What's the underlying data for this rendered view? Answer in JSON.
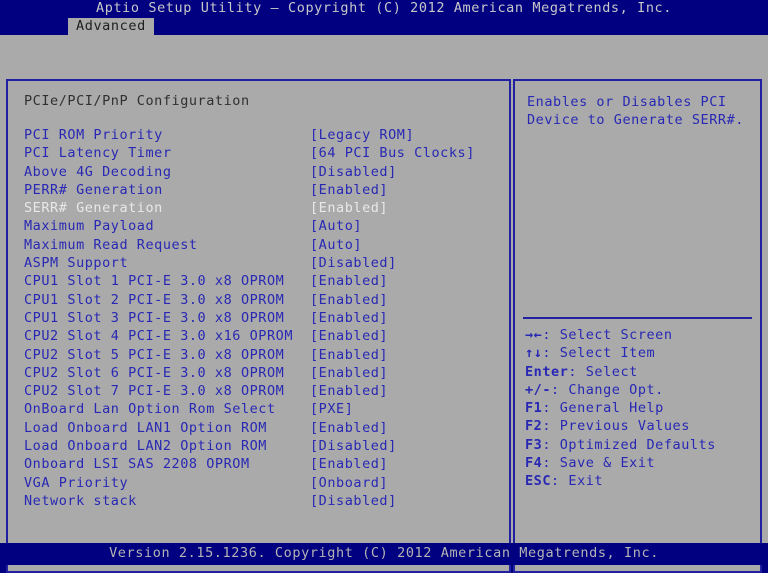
{
  "header": {
    "title": "Aptio Setup Utility – Copyright (C) 2012 American Megatrends, Inc.",
    "tabs": [
      {
        "label": "Advanced",
        "active": true
      }
    ]
  },
  "main": {
    "section_title": "PCIe/PCI/PnP Configuration",
    "options": [
      {
        "label": "PCI ROM Priority",
        "value": "[Legacy ROM]",
        "selected": false
      },
      {
        "label": "PCI Latency Timer",
        "value": "[64 PCI Bus Clocks]",
        "selected": false
      },
      {
        "label": "Above 4G Decoding",
        "value": "[Disabled]",
        "selected": false
      },
      {
        "label": "PERR# Generation",
        "value": "[Enabled]",
        "selected": false
      },
      {
        "label": "SERR# Generation",
        "value": "[Enabled]",
        "selected": true
      },
      {
        "label": "Maximum Payload",
        "value": "[Auto]",
        "selected": false
      },
      {
        "label": "Maximum Read Request",
        "value": "[Auto]",
        "selected": false
      },
      {
        "label": "ASPM Support",
        "value": "[Disabled]",
        "selected": false
      },
      {
        "label": "CPU1 Slot 1 PCI-E 3.0 x8 OPROM",
        "value": "[Enabled]",
        "selected": false
      },
      {
        "label": "CPU1 Slot 2 PCI-E 3.0 x8 OPROM",
        "value": "[Enabled]",
        "selected": false
      },
      {
        "label": "CPU1 Slot 3 PCI-E 3.0 x8 OPROM",
        "value": "[Enabled]",
        "selected": false
      },
      {
        "label": "CPU2 Slot 4 PCI-E 3.0 x16 OPROM",
        "value": "[Enabled]",
        "selected": false
      },
      {
        "label": "CPU2 Slot 5 PCI-E 3.0 x8 OPROM",
        "value": "[Enabled]",
        "selected": false
      },
      {
        "label": "CPU2 Slot 6 PCI-E 3.0 x8 OPROM",
        "value": "[Enabled]",
        "selected": false
      },
      {
        "label": "CPU2 Slot 7 PCI-E 3.0 x8 OPROM",
        "value": "[Enabled]",
        "selected": false
      },
      {
        "label": "OnBoard Lan Option Rom Select",
        "value": "[PXE]",
        "selected": false
      },
      {
        "label": "Load Onboard LAN1 Option ROM",
        "value": "[Enabled]",
        "selected": false
      },
      {
        "label": "Load Onboard LAN2 Option ROM",
        "value": "[Disabled]",
        "selected": false
      },
      {
        "label": "Onboard LSI SAS 2208 OPROM",
        "value": "[Enabled]",
        "selected": false
      },
      {
        "label": "VGA Priority",
        "value": "[Onboard]",
        "selected": false
      },
      {
        "label": "Network stack",
        "value": "[Disabled]",
        "selected": false
      }
    ]
  },
  "help": {
    "text": "Enables or Disables PCI Device to Generate SERR#."
  },
  "keys": [
    {
      "glyph": "→←",
      "label": ": Select Screen"
    },
    {
      "glyph": "↑↓",
      "label": ": Select Item"
    },
    {
      "glyph": "Enter",
      "label": ": Select"
    },
    {
      "glyph": "+/-",
      "label": ": Change Opt."
    },
    {
      "glyph": "F1",
      "label": ": General Help"
    },
    {
      "glyph": "F2",
      "label": ": Previous Values"
    },
    {
      "glyph": "F3",
      "label": ": Optimized Defaults"
    },
    {
      "glyph": "F4",
      "label": ": Save & Exit"
    },
    {
      "glyph": "ESC",
      "label": ": Exit"
    }
  ],
  "footer": {
    "text": "Version 2.15.1236. Copyright (C) 2012 American Megatrends, Inc."
  },
  "colors": {
    "background_blue": "#000080",
    "panel_gray": "#aaaaaa",
    "border_blue": "#2020a0",
    "text_blue": "#2828b4",
    "text_selected": "#e8e8e8",
    "text_header": "#c8c8c8",
    "text_title": "#303030"
  }
}
